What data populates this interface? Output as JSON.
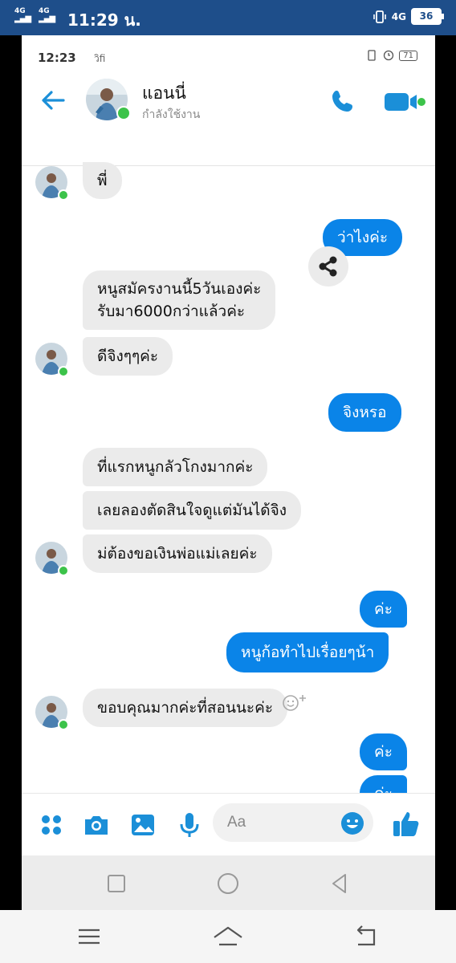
{
  "outer_status": {
    "network_1": "4G",
    "network_2": "4G",
    "time": "11:29 น.",
    "network_right": "4G",
    "battery": "36"
  },
  "inner_status": {
    "time": "12:23",
    "network": "วิfi",
    "battery": "71"
  },
  "header": {
    "name": "แอนนี่",
    "status": "กำลังใช้งาน"
  },
  "messages": [
    {
      "side": "in",
      "text": "พี่"
    },
    {
      "side": "out",
      "text": "ว่าไงค่ะ"
    },
    {
      "side": "in",
      "text": "หนูสมัครงานนี้5วันเองค่ะ"
    },
    {
      "side": "in",
      "text": "รับมา6000กว่าแล้วค่ะ"
    },
    {
      "side": "in",
      "text": "ดีจิงๆๆค่ะ"
    },
    {
      "side": "out",
      "text": "จิงหรอ"
    },
    {
      "side": "in",
      "text": "ที่แรกหนูกลัวโกงมากค่ะ"
    },
    {
      "side": "in",
      "text": "เลยลองตัดสินใจดูแต่มันได้จิง"
    },
    {
      "side": "in",
      "text": "ม่ต้องขอเงินพ่อแม่เลยค่ะ"
    },
    {
      "side": "out",
      "text": "ค่ะ"
    },
    {
      "side": "out",
      "text": "หนูก้อทำไปเรื่อยๆน้า"
    },
    {
      "side": "in",
      "text": "ขอบคุณมากค่ะที่สอนนะค่ะ"
    },
    {
      "side": "out",
      "text": "ค่ะ"
    },
    {
      "side": "out",
      "text": "ค่ะ"
    }
  ],
  "composer": {
    "placeholder": "Aa"
  },
  "colors": {
    "accent": "#0a84e8",
    "icon_teal": "#1b8fd8",
    "online": "#3cc34a",
    "incoming_bubble": "#ebebeb",
    "outer_status_bg": "#1e4e8a"
  },
  "icons": [
    "back-arrow-icon",
    "phone-icon",
    "video-camera-icon",
    "share-icon",
    "add-reaction-icon",
    "grid-menu-icon",
    "camera-icon",
    "image-icon",
    "microphone-icon",
    "emoji-icon",
    "thumbs-up-icon",
    "recents-icon",
    "home-icon",
    "back-icon",
    "menu-icon"
  ]
}
